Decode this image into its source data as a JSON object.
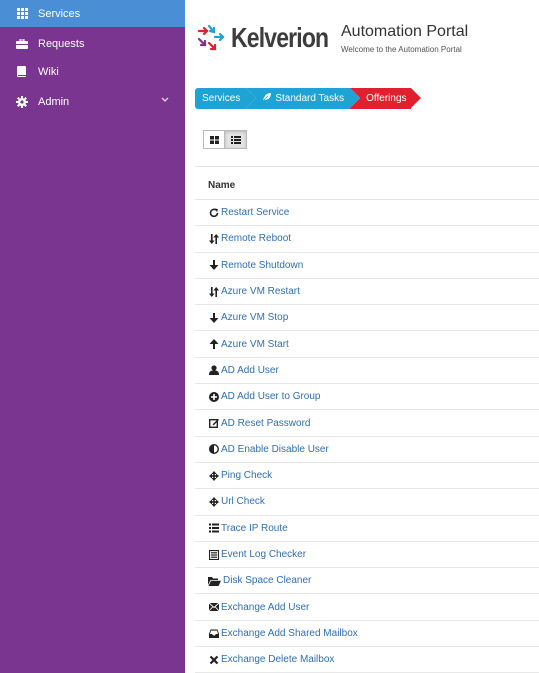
{
  "sidebar": {
    "items": [
      {
        "label": "Services",
        "icon": "grid-icon"
      },
      {
        "label": "Requests",
        "icon": "briefcase-icon"
      },
      {
        "label": "Wiki",
        "icon": "book-icon"
      },
      {
        "label": "Admin",
        "icon": "gear-icon"
      }
    ],
    "active_color": "#4a8fd6",
    "background": "#7a3590"
  },
  "header": {
    "logo_text": "Kelverion",
    "title": "Automation Portal",
    "subtitle": "Welcome to the Automation Portal"
  },
  "breadcrumb": {
    "items": [
      "Services",
      "Standard Tasks",
      "Offerings"
    ]
  },
  "table": {
    "header": "Name",
    "rows": [
      {
        "label": "Restart Service",
        "icon": "refresh-icon"
      },
      {
        "label": "Remote Reboot",
        "icon": "sort-arrows-icon"
      },
      {
        "label": "Remote Shutdown",
        "icon": "arrow-down-icon"
      },
      {
        "label": "Azure VM Restart",
        "icon": "sort-arrows-icon"
      },
      {
        "label": "Azure VM Stop",
        "icon": "arrow-down-icon"
      },
      {
        "label": "Azure VM Start",
        "icon": "arrow-up-icon"
      },
      {
        "label": "AD Add User",
        "icon": "user-icon"
      },
      {
        "label": "AD Add User to Group",
        "icon": "plus-circle-icon"
      },
      {
        "label": "AD Reset Password",
        "icon": "edit-icon"
      },
      {
        "label": "AD Enable Disable User",
        "icon": "half-circle-icon"
      },
      {
        "label": "Ping Check",
        "icon": "move-arrows-icon"
      },
      {
        "label": "Url Check",
        "icon": "move-arrows-icon"
      },
      {
        "label": "Trace IP Route",
        "icon": "list-icon"
      },
      {
        "label": "Event Log Checker",
        "icon": "log-icon"
      },
      {
        "label": "Disk Space Cleaner",
        "icon": "folder-open-icon"
      },
      {
        "label": "Exchange Add User",
        "icon": "envelope-icon"
      },
      {
        "label": "Exchange Add Shared Mailbox",
        "icon": "inbox-icon"
      },
      {
        "label": "Exchange Delete Mailbox",
        "icon": "x-icon"
      }
    ]
  },
  "colors": {
    "breadcrumb_blue": "#1ea3d6",
    "breadcrumb_red": "#e0202e",
    "link": "#2f6fb5"
  }
}
